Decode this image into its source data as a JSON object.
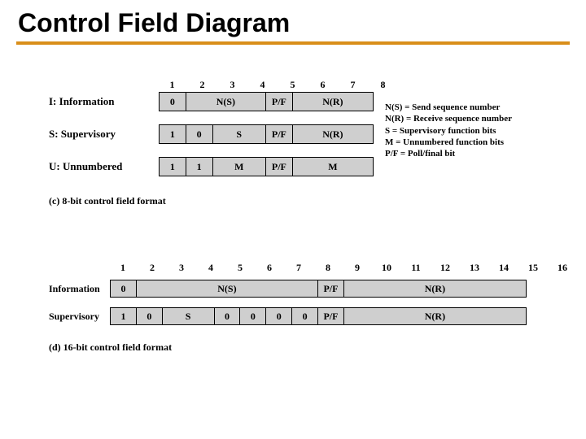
{
  "title": "Control Field Diagram",
  "legend": {
    "l1": "N(S) = Send sequence number",
    "l2": "N(R) = Receive sequence number",
    "l3": "S = Supervisory function bits",
    "l4": "M = Unnumbered function bits",
    "l5": "P/F = Poll/final bit"
  },
  "cols8": {
    "c1": "1",
    "c2": "2",
    "c3": "3",
    "c4": "4",
    "c5": "5",
    "c6": "6",
    "c7": "7",
    "c8": "8"
  },
  "rows8": {
    "i": {
      "label": "I: Information",
      "f1": "0",
      "f2": "N(S)",
      "f3": "P/F",
      "f4": "N(R)"
    },
    "s": {
      "label": "S: Supervisory",
      "f1": "1",
      "f2": "0",
      "f3": "S",
      "f4": "P/F",
      "f5": "N(R)"
    },
    "u": {
      "label": "U: Unnumbered",
      "f1": "1",
      "f2": "1",
      "f3": "M",
      "f4": "P/F",
      "f5": "M"
    }
  },
  "caption8": "(c) 8-bit control field format",
  "cols16": {
    "c1": "1",
    "c2": "2",
    "c3": "3",
    "c4": "4",
    "c5": "5",
    "c6": "6",
    "c7": "7",
    "c8": "8",
    "c9": "9",
    "c10": "10",
    "c11": "11",
    "c12": "12",
    "c13": "13",
    "c14": "14",
    "c15": "15",
    "c16": "16"
  },
  "rows16": {
    "i": {
      "label": "Information",
      "f1": "0",
      "f2": "N(S)",
      "f3": "P/F",
      "f4": "N(R)"
    },
    "s": {
      "label": "Supervisory",
      "f1": "1",
      "f2": "0",
      "f3": "S",
      "f4": "0",
      "f5": "0",
      "f6": "0",
      "f7": "0",
      "f8": "P/F",
      "f9": "N(R)"
    }
  },
  "caption16": "(d) 16-bit control field format"
}
